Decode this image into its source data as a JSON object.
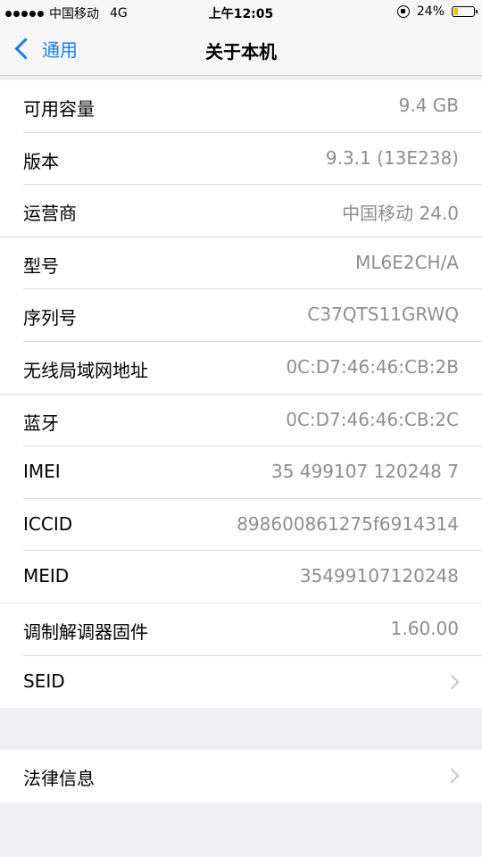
{
  "status_bar": {
    "carrier": "中国移动",
    "network": "4G",
    "time": "上午12:05",
    "battery_text": "24%",
    "battery_level": 0.24,
    "battery_color": "#f5c400"
  },
  "nav": {
    "back_label": "通用",
    "title": "关于本机"
  },
  "rows": [
    {
      "label": "可用容量",
      "value": "9.4 GB"
    },
    {
      "label": "版本",
      "value": "9.3.1 (13E238)"
    },
    {
      "label": "运营商",
      "value": "中国移动 24.0"
    },
    {
      "label": "型号",
      "value": "ML6E2CH/A"
    },
    {
      "label": "序列号",
      "value": "C37QTS11GRWQ"
    },
    {
      "label": "无线局域网地址",
      "value": "0C:D7:46:46:CB:2B"
    },
    {
      "label": "蓝牙",
      "value": "0C:D7:46:46:CB:2C"
    },
    {
      "label": "IMEI",
      "value": "35 499107 120248 7"
    },
    {
      "label": "ICCID",
      "value": "898600861275f6914314"
    },
    {
      "label": "MEID",
      "value": "35499107120248"
    },
    {
      "label": "调制解调器固件",
      "value": "1.60.00"
    },
    {
      "label": "SEID",
      "value": ""
    }
  ],
  "legal": {
    "label": "法律信息"
  },
  "colors": {
    "accent": "#1a7cf5",
    "background": "#efeff4",
    "secondary_text": "#8e8e93"
  }
}
